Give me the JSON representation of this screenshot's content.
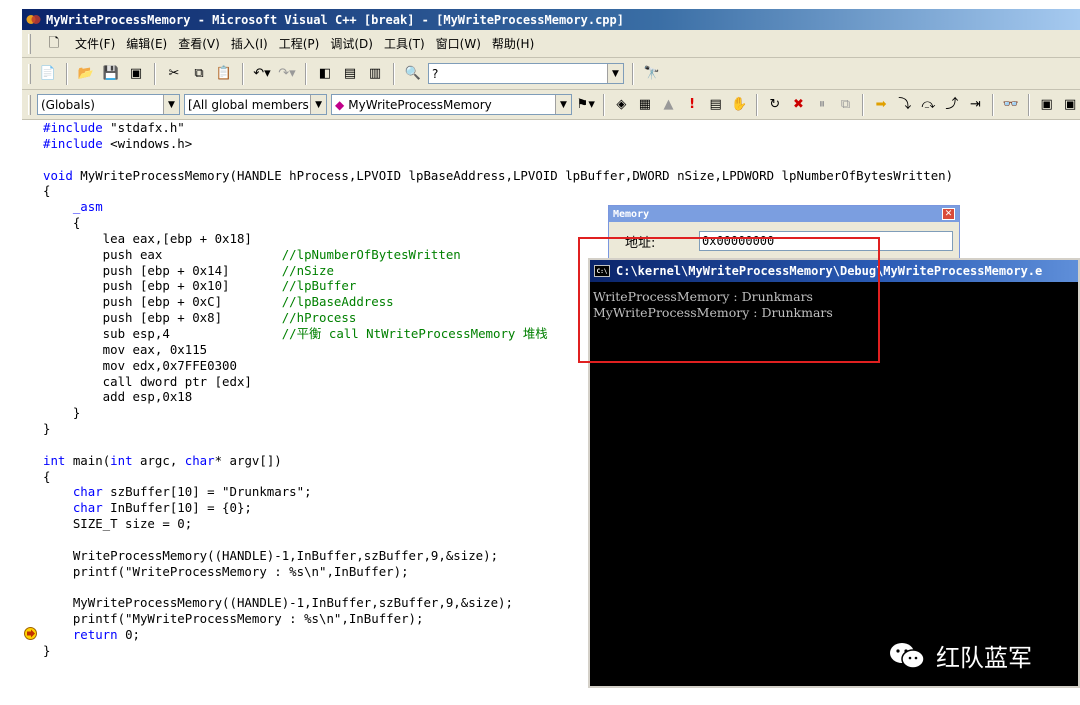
{
  "window": {
    "title": "MyWriteProcessMemory - Microsoft Visual C++ [break] - [MyWriteProcessMemory.cpp]"
  },
  "menubar": {
    "items": [
      "文件(F)",
      "编辑(E)",
      "查看(V)",
      "插入(I)",
      "工程(P)",
      "调试(D)",
      "工具(T)",
      "窗口(W)",
      "帮助(H)"
    ]
  },
  "toolbar": {
    "find_combo_value": "?"
  },
  "wizardbar": {
    "class_combo": "(Globals)",
    "filter_combo": "[All global members",
    "member_combo": "MyWriteProcessMemory"
  },
  "memory_window": {
    "title": "Memory",
    "address_label": "地址:",
    "address_value": "0x00000000"
  },
  "console": {
    "title": "C:\\kernel\\MyWriteProcessMemory\\Debug\\MyWriteProcessMemory.e",
    "lines": [
      "WriteProcessMemory : Drunkmars",
      "MyWriteProcessMemory : Drunkmars"
    ]
  },
  "watermark": {
    "text": "红队蓝军"
  },
  "code": {
    "lines": [
      "#include \"stdafx.h\"",
      "#include <windows.h>",
      "",
      "void MyWriteProcessMemory(HANDLE hProcess,LPVOID lpBaseAddress,LPVOID lpBuffer,DWORD nSize,LPDWORD lpNumberOfBytesWritten)",
      "{",
      "    _asm",
      "    {",
      "        lea eax,[ebp + 0x18]",
      "        push eax                //lpNumberOfBytesWritten",
      "        push [ebp + 0x14]       //nSize",
      "        push [ebp + 0x10]       //lpBuffer",
      "        push [ebp + 0xC]        //lpBaseAddress",
      "        push [ebp + 0x8]        //hProcess",
      "        sub esp,4               //平衡 call NtWriteProcessMemory 堆栈",
      "        mov eax, 0x115",
      "        mov edx,0x7FFE0300",
      "        call dword ptr [edx]",
      "        add esp,0x18",
      "    }",
      "}",
      "",
      "int main(int argc, char* argv[])",
      "{",
      "    char szBuffer[10] = \"Drunkmars\";",
      "    char InBuffer[10] = {0};",
      "    SIZE_T size = 0;",
      "",
      "    WriteProcessMemory((HANDLE)-1,InBuffer,szBuffer,9,&size);",
      "    printf(\"WriteProcessMemory : %s\\n\",InBuffer);",
      "",
      "    MyWriteProcessMemory((HANDLE)-1,InBuffer,szBuffer,9,&size);",
      "    printf(\"MyWriteProcessMemory : %s\\n\",InBuffer);",
      "    return 0;",
      "}"
    ]
  }
}
